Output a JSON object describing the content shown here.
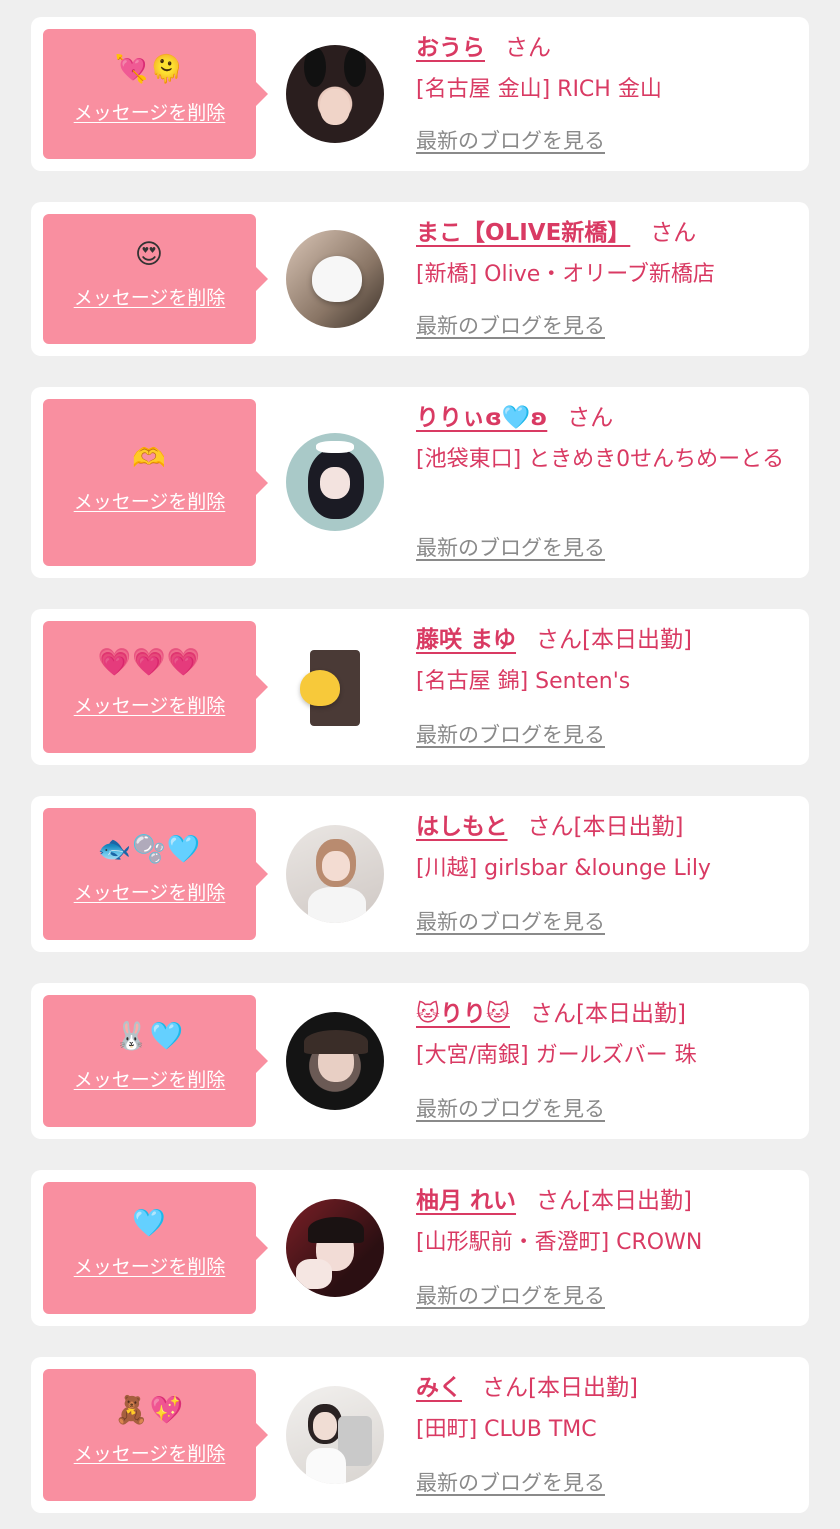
{
  "delete_label": "メッセージを削除",
  "blog_label": "最新のブログを見る",
  "san_label": "さん",
  "colors": {
    "background": "#efefef",
    "card": "#ffffff",
    "bubble": "#f98fa0",
    "accent": "#d93a63",
    "link_gray": "#8a8a8a"
  },
  "messages": [
    {
      "emoji": "💘🫠",
      "name": "おうら",
      "suffix": "",
      "shop": "[名古屋 金山] RICH 金山",
      "avatar_icon": "bunny-ears-girl-photo"
    },
    {
      "emoji": "😍",
      "name": "まこ【OLIVE新橋】",
      "suffix": "",
      "shop": "[新橋] Olive・オリーブ新橋店",
      "avatar_icon": "white-heart-covered-face-photo"
    },
    {
      "emoji": "🫶",
      "name": "りりぃɞ🩵ʚ",
      "suffix": "",
      "shop": "[池袋東口] ときめき0せんちめーとる",
      "avatar_icon": "maid-girl-glasses-photo"
    },
    {
      "emoji": "💗💗💗",
      "name": "藤咲 まゆ",
      "suffix": "[本日出勤]",
      "shop": "[名古屋 錦] Senten's",
      "avatar_icon": "yellow-heart-covered-face-photo"
    },
    {
      "emoji": "🐟🫧🩵",
      "name": "はしもと",
      "suffix": "[本日出勤]",
      "shop": "[川越] girlsbar &lounge Lily",
      "avatar_icon": "peace-sign-girl-photo"
    },
    {
      "emoji": "🐰🩵",
      "name": "🐱りり🐱",
      "suffix": "[本日出勤]",
      "shop": "[大宮/南銀] ガールズバー 珠",
      "avatar_icon": "dark-doodle-girl-photo"
    },
    {
      "emoji": "🩵",
      "name": "柚月 れい",
      "suffix": "[本日出勤]",
      "shop": "[山形駅前・香澄町] CROWN",
      "avatar_icon": "red-dark-girl-photo"
    },
    {
      "emoji": "🧸💖",
      "name": "みく",
      "suffix": "[本日出勤]",
      "shop": "[田町] CLUB TMC",
      "avatar_icon": "mirror-selfie-girl-photo"
    }
  ]
}
